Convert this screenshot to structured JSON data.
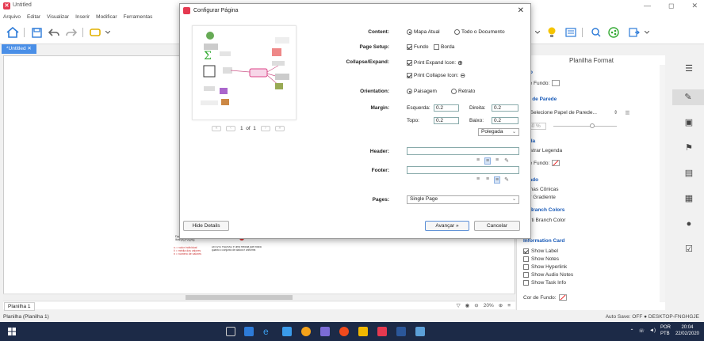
{
  "app": {
    "title": "Untitled",
    "menu": [
      "Arquivo",
      "Editar",
      "Visualizar",
      "Inserir",
      "Modificar",
      "Ferramentas"
    ],
    "window_controls": [
      "—",
      "◻",
      "✕"
    ]
  },
  "tabs": {
    "document": "*Untitled ✕"
  },
  "canvas_snippet": {
    "formula": "Dp = \\sqrt{\\frac{\\sum(x_i - \\bar{x})^2}{n}}",
    "legend_lines": [
      "xᵢ = valor individual",
      "x̄ = média dos valores",
      "n = número de valores"
    ],
    "note": "DESVIO PADRÃO é uma medida que indica quanto o conjunto de dados é uniforme."
  },
  "sheetbar": {
    "sheet_name": "Planilha 1",
    "zoom": "20%"
  },
  "statusbar": {
    "left": "Planilha (Planilha 1)",
    "right": "Auto Save: OFF  ●  DESKTOP-FNGHGJE"
  },
  "panel": {
    "title": "Planilha Format",
    "sections": {
      "fundo": "ndo",
      "cor_fundo": "r de Fundo:",
      "papel": "pel de Parede",
      "papel_select": "Selecione Papel de Parede...",
      "opacity": "60 %",
      "legenda": "enda",
      "mostrar_legenda": "Mostrar Legenda",
      "cor_fundo2": "r de Fundo:",
      "avancado": "nçado",
      "linhas_conicas": "Linhas Cônicas",
      "cor_gradiente": "Cor Gradiente",
      "multi_branch_colors": "lti Branch Colors",
      "multi_branch_color": "Multi Branch Color",
      "information_card": "Information Card",
      "show_label": "Show Label",
      "show_notes": "Show Notes",
      "show_hyperlink": "Show Hyperlink",
      "show_audio_notes": "Show Audio Notes",
      "show_task_info": "Show Task Info",
      "cor_fundo3": "Cor de Fundo:"
    }
  },
  "dialog": {
    "title": "Configurar Página",
    "content_label": "Content:",
    "content_opts": [
      "Mapa Atual",
      "Todo o Documento"
    ],
    "page_setup_label": "Page Setup:",
    "page_setup_opts": [
      "Fundo",
      "Borda"
    ],
    "collapse_label": "Collapse/Expand:",
    "collapse_opts": [
      "Print Expand Icon:",
      "Print Collapse Icon:"
    ],
    "orientation_label": "Orientation:",
    "orientation_opts": [
      "Paisagem",
      "Retrato"
    ],
    "margin_label": "Margin:",
    "margin_fields": {
      "esquerda_label": "Esquerda:",
      "esquerda": "0.2",
      "direita_label": "Direita:",
      "direita": "0.2",
      "topo_label": "Topo:",
      "topo": "0.2",
      "baixo_label": "Baixo:",
      "baixo": "0.2"
    },
    "unit": "Polegada",
    "header_label": "Header:",
    "footer_label": "Footer:",
    "pages_label": "Pages:",
    "pages_value": "Single Page",
    "preview_page": "1  of  1",
    "hide_details": "Hide Details",
    "advance_btn": "Avançar »",
    "cancel_btn": "Cancelar"
  },
  "taskbar": {
    "tray_lang": "POR\nPTB",
    "time": "20:04",
    "date": "22/02/2020"
  },
  "colors": {
    "accent": "#4a8fe7",
    "brand": "#e53950",
    "taskbar": "#1c2a47",
    "section": "#1a5bb8"
  }
}
